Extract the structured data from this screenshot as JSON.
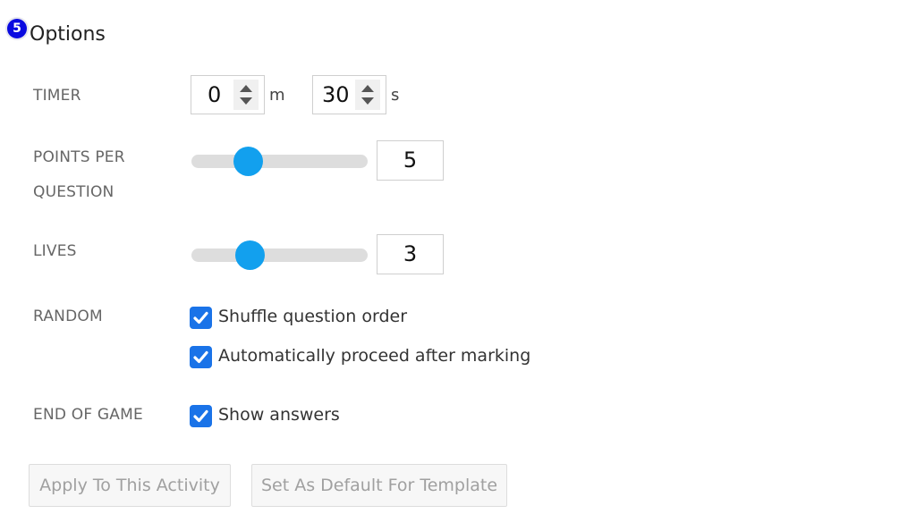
{
  "header": {
    "badge": "5",
    "title": "Options"
  },
  "timer": {
    "label": "TIMER",
    "minutes": {
      "value": "0",
      "unit": "m"
    },
    "seconds": {
      "value": "30",
      "unit": "s"
    }
  },
  "points_per_question": {
    "label_line1": "POINTS PER",
    "label_line2": "QUESTION",
    "value": "5",
    "slider_fraction": 0.32
  },
  "lives": {
    "label": "LIVES",
    "value": "3",
    "slider_fraction": 0.33
  },
  "random": {
    "label": "RANDOM",
    "options": [
      {
        "label": "Shuffle question order",
        "checked": true
      },
      {
        "label": "Automatically proceed after marking",
        "checked": true
      }
    ]
  },
  "end_of_game": {
    "label": "END OF GAME",
    "options": [
      {
        "label": "Show answers",
        "checked": true
      }
    ]
  },
  "buttons": {
    "apply": "Apply To This Activity",
    "set_default": "Set As Default For Template"
  },
  "colors": {
    "accent": "#12a0ee",
    "checkbox": "#1a73e8",
    "badge": "#0a0ae0"
  }
}
